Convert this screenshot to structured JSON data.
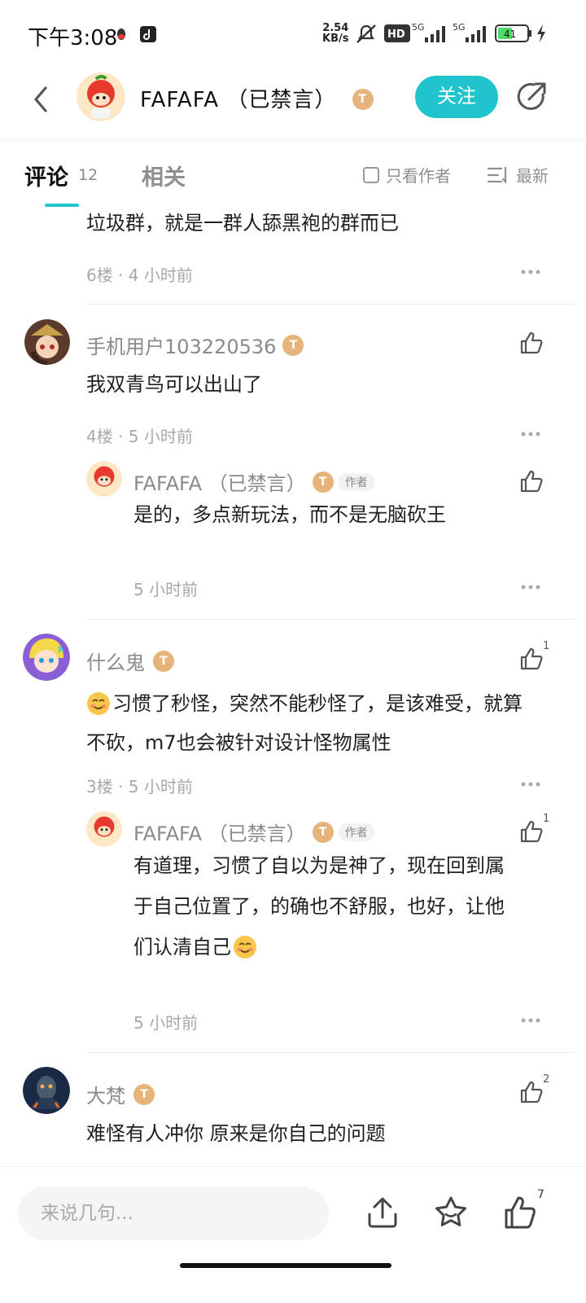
{
  "status_bar": {
    "time": "下午3:08",
    "net_speed_value": "2.54",
    "net_speed_unit": "KB/s",
    "battery": "41"
  },
  "header": {
    "title": "FAFAFA （已禁言）",
    "follow_label": "关注"
  },
  "tabs": {
    "comments_label": "评论",
    "comments_count": "12",
    "related_label": "相关",
    "only_author_label": "只看作者",
    "sort_label": "最新"
  },
  "comments": [
    {
      "text": "垃圾群，就是一群人舔黑袍的群而已",
      "meta": "6楼 · 4 小时前"
    },
    {
      "user": "手机用户103220536",
      "text": "我双青鸟可以出山了",
      "meta": "4楼 · 5 小时前",
      "reply": {
        "user": "FAFAFA （已禁言）",
        "tag": "作者",
        "text": "是的，多点新玩法，而不是无脑砍王",
        "meta": "5 小时前"
      }
    },
    {
      "user": "什么鬼",
      "likes": "1",
      "text_line1": "习惯了秒怪，突然不能秒怪了，是该难受，就算",
      "text_line2": "不砍，m7也会被针对设计怪物属性",
      "meta": "3楼 · 5 小时前",
      "reply": {
        "user": "FAFAFA （已禁言）",
        "tag": "作者",
        "likes": "1",
        "text_line1": "有道理，习惯了自以为是神了，现在回到属",
        "text_line2": "于自己位置了，的确也不舒服，也好，让他",
        "text_line3": "们认清自己",
        "meta": "5 小时前"
      }
    },
    {
      "user": "大梵",
      "likes": "2",
      "text": "难怪有人冲你 原来是你自己的问题"
    }
  ],
  "bottom_bar": {
    "input_placeholder": "来说几句...",
    "like_count": "7"
  },
  "colors": {
    "accent": "#1fc4cc",
    "badge": "#e6b37a",
    "meta_text": "#a8a8a8"
  },
  "icons": [
    "back-arrow-icon",
    "share-icon",
    "checkbox-icon",
    "sort-icon",
    "more-dots-icon",
    "thumbs-up-icon",
    "upload-icon",
    "star-icon",
    "smile-emoji-icon",
    "mute-bell-icon",
    "signal-icon",
    "battery-icon",
    "charging-icon"
  ]
}
